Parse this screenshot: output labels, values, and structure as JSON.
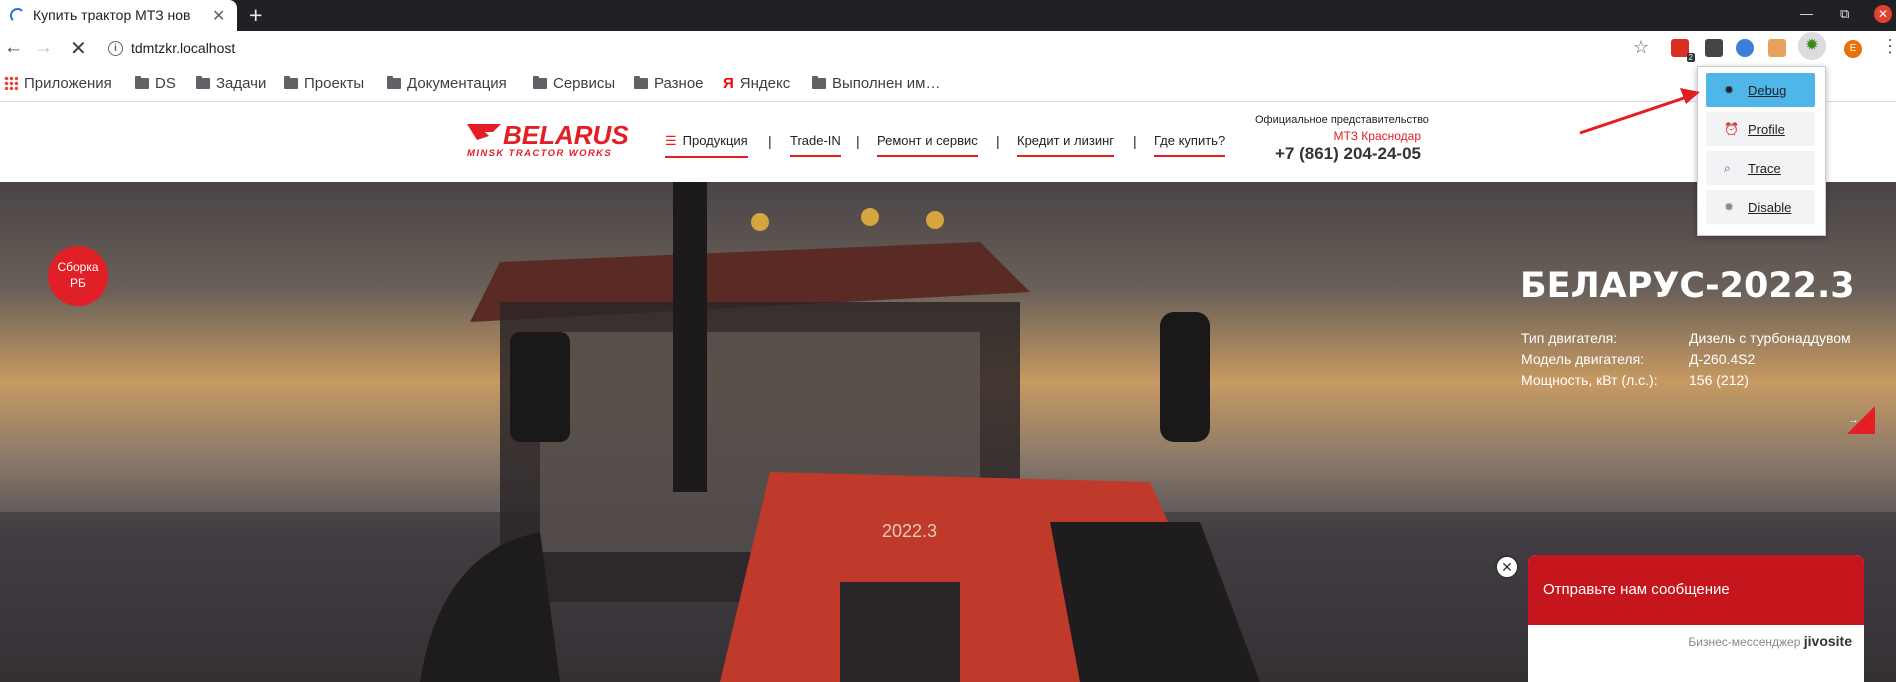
{
  "browser": {
    "tab_title": "Купить трактор МТЗ нов",
    "url": "tdmtzkr.localhost",
    "bookmarks": [
      "Приложения",
      "DS",
      "Задачи",
      "Проекты",
      "Документация",
      "Сервисы",
      "Разное",
      "Яндекс",
      "Выполнен им…"
    ],
    "extension_badge": "2",
    "profile_initial": "E"
  },
  "debug_menu": {
    "items": [
      {
        "label": "Debug",
        "icon": "bug-icon",
        "active": true
      },
      {
        "label": "Profile",
        "icon": "clock-icon",
        "active": false
      },
      {
        "label": "Trace",
        "icon": "search-doc-icon",
        "active": false
      },
      {
        "label": "Disable",
        "icon": "bug-disabled-icon",
        "active": false
      }
    ]
  },
  "site": {
    "logo_main": "BELARUS",
    "logo_sub": "MINSK TRACTOR WORKS",
    "nav": [
      "Продукция",
      "Trade-IN",
      "Ремонт и сервис",
      "Кредит и лизинг",
      "Где купить?"
    ],
    "rep_label": "Официальное представительство",
    "rep_city": "МТЗ Краснодар",
    "rep_phone": "+7 (861) 204-24-05"
  },
  "hero": {
    "badge": "Сборка РБ",
    "title": "БЕЛАРУС-2022.3",
    "specs": [
      {
        "label": "Тип двигателя:",
        "value": "Дизель с турбонаддувом"
      },
      {
        "label": "Модель двигателя:",
        "value": "Д-260.4S2"
      },
      {
        "label": "Мощность, кВт (л.с.):",
        "value": "156 (212)"
      }
    ],
    "tractor_plate": "2022.3"
  },
  "chat": {
    "message": "Отправьте нам сообщение",
    "footer": "Бизнес-мессенджер",
    "brand": "jivosite"
  },
  "colors": {
    "accent_red": "#e31e24",
    "debug_active": "#4fb6e9",
    "chat_red": "#c5161d"
  }
}
